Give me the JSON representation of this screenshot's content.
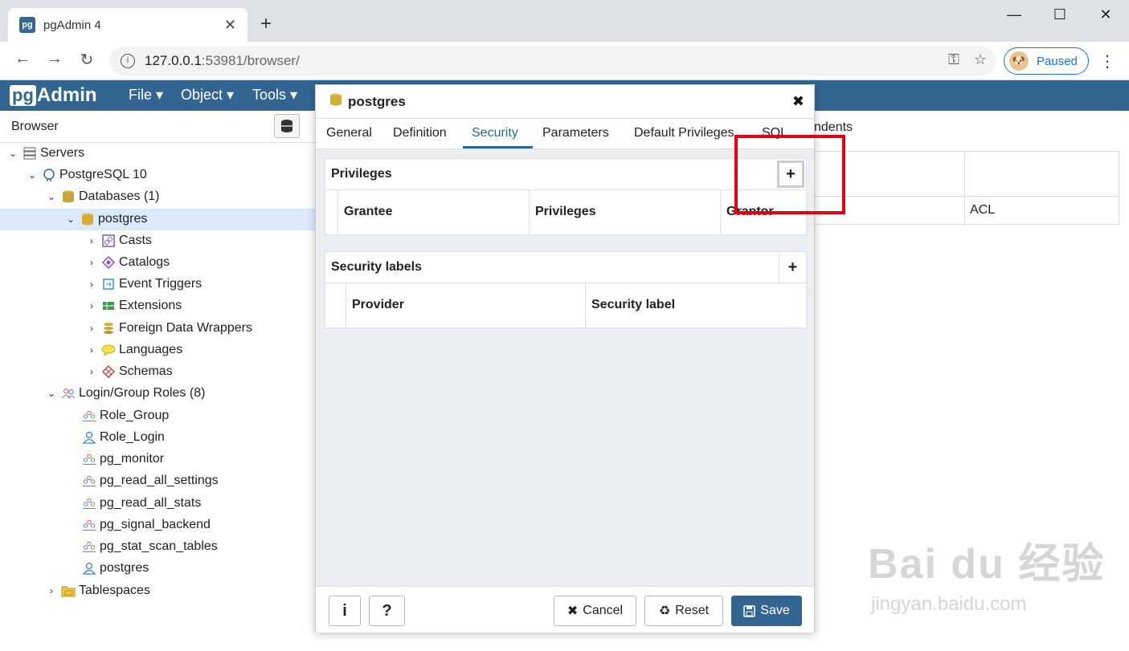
{
  "browser": {
    "tab_title": "pgAdmin 4",
    "tab_favicon": "pg",
    "url_host": "127.0.0.1",
    "url_rest": ":53981/browser/",
    "profile_status": "Paused"
  },
  "app": {
    "logo_pg": "pg",
    "logo_admin": "Admin",
    "menu": [
      "File ▾",
      "Object ▾",
      "Tools ▾"
    ]
  },
  "sidebar": {
    "title": "Browser",
    "tree": [
      {
        "label": "Servers",
        "icon": "servers-icon"
      },
      {
        "label": "PostgreSQL 10",
        "icon": "elephant-icon"
      },
      {
        "label": "Databases (1)",
        "icon": "databases-icon"
      },
      {
        "label": "postgres",
        "icon": "database-icon"
      },
      {
        "label": "Casts",
        "icon": "casts-icon"
      },
      {
        "label": "Catalogs",
        "icon": "catalogs-icon"
      },
      {
        "label": "Event Triggers",
        "icon": "event-triggers-icon"
      },
      {
        "label": "Extensions",
        "icon": "extensions-icon"
      },
      {
        "label": "Foreign Data Wrappers",
        "icon": "fdw-icon"
      },
      {
        "label": "Languages",
        "icon": "languages-icon"
      },
      {
        "label": "Schemas",
        "icon": "schemas-icon"
      },
      {
        "label": "Login/Group Roles (8)",
        "icon": "roles-icon"
      },
      {
        "label": "Role_Group",
        "icon": "group-role-icon"
      },
      {
        "label": "Role_Login",
        "icon": "login-role-icon"
      },
      {
        "label": "pg_monitor",
        "icon": "group-role-icon"
      },
      {
        "label": "pg_read_all_settings",
        "icon": "group-role-icon"
      },
      {
        "label": "pg_read_all_stats",
        "icon": "group-role-icon"
      },
      {
        "label": "pg_signal_backend",
        "icon": "group-role-icon"
      },
      {
        "label": "pg_stat_scan_tables",
        "icon": "group-role-icon"
      },
      {
        "label": "postgres",
        "icon": "login-role-icon"
      },
      {
        "label": "Tablespaces",
        "icon": "tablespaces-icon"
      }
    ]
  },
  "right_panel": {
    "tab_partial": "ndents",
    "acl_header": "ACL"
  },
  "dialog": {
    "title": "postgres",
    "tabs": [
      "General",
      "Definition",
      "Security",
      "Parameters",
      "Default Privileges",
      "SQL"
    ],
    "active_tab": "Security",
    "privileges": {
      "title": "Privileges",
      "columns": [
        "Grantee",
        "Privileges",
        "Grantor"
      ]
    },
    "security_labels": {
      "title": "Security labels",
      "columns": [
        "Provider",
        "Security label"
      ]
    },
    "footer": {
      "info": "i",
      "help": "?",
      "cancel": "Cancel",
      "reset": "Reset",
      "save": "Save"
    }
  },
  "watermark": {
    "brand": "Bai du 经验",
    "site": "jingyan.baidu.com"
  },
  "colors": {
    "accent": "#326690",
    "highlight": "#e60012",
    "selected_row": "#dbeafd"
  }
}
